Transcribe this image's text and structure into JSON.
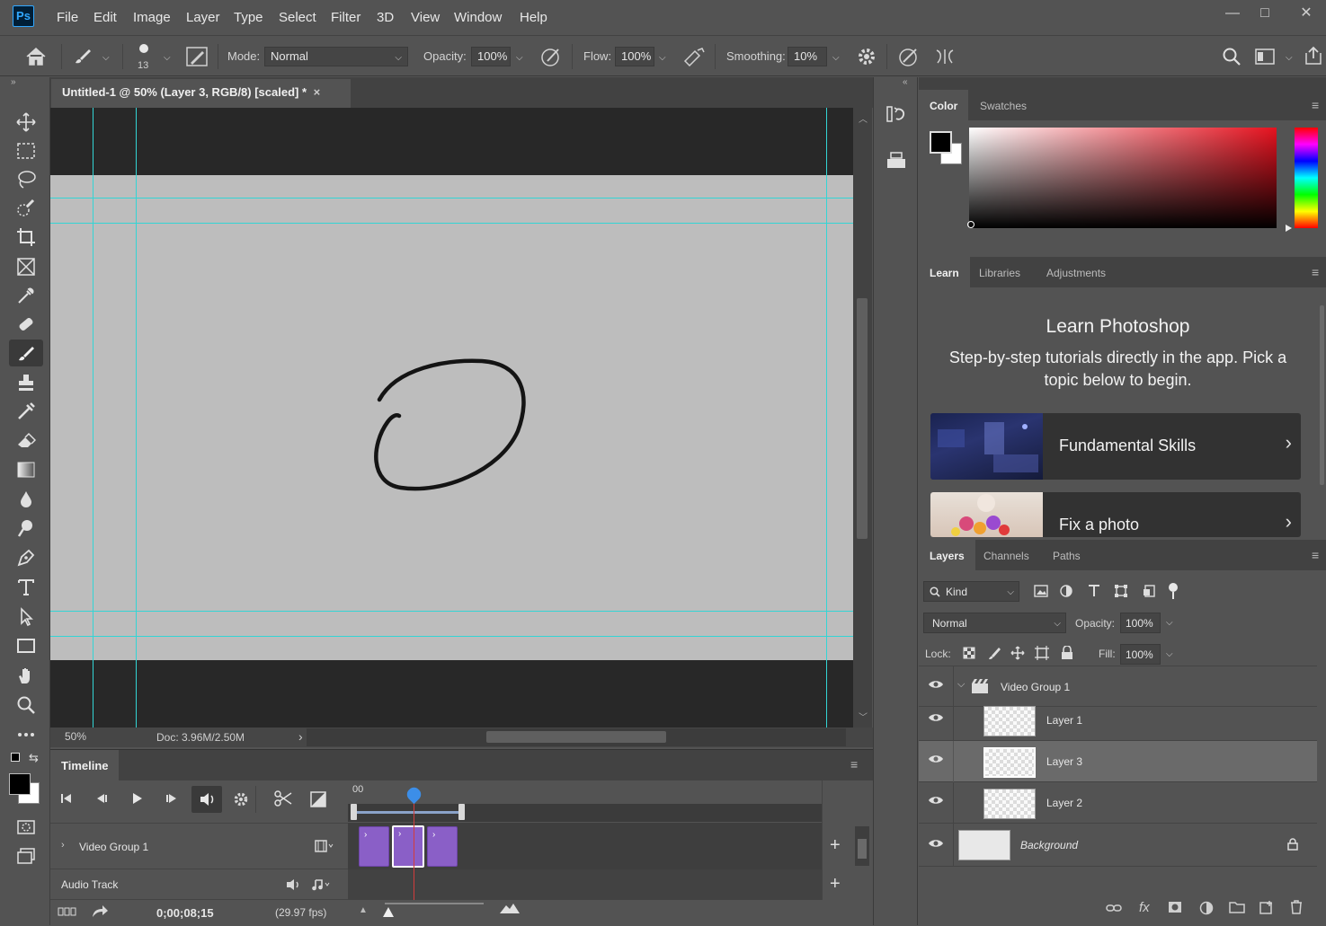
{
  "app": {
    "logo_text": "Ps"
  },
  "menu": [
    "File",
    "Edit",
    "Image",
    "Layer",
    "Type",
    "Select",
    "Filter",
    "3D",
    "View",
    "Window",
    "Help"
  ],
  "window_controls": {
    "minimize": "—",
    "restore": "□",
    "close": "✕"
  },
  "options": {
    "brush_size": "13",
    "mode_label": "Mode:",
    "mode_value": "Normal",
    "opacity_label": "Opacity:",
    "opacity_value": "100%",
    "flow_label": "Flow:",
    "flow_value": "100%",
    "smoothing_label": "Smoothing:",
    "smoothing_value": "10%"
  },
  "document": {
    "tab_title": "Untitled-1 @ 50% (Layer 3, RGB/8) [scaled] *",
    "close_glyph": "×",
    "zoom": "50%",
    "doc_info": "Doc: 3.96M/2.50M",
    "status_arrow": "›"
  },
  "timeline": {
    "title": "Timeline",
    "ruler_start": "00",
    "video_group_label": "Video Group 1",
    "audio_track_label": "Audio Track",
    "timecode": "0;00;08;15",
    "fps": "(29.97 fps)"
  },
  "color_panel": {
    "tabs": [
      "Color",
      "Swatches"
    ],
    "foreground": "#000000",
    "background": "#ffffff"
  },
  "learn_panel": {
    "tabs": [
      "Learn",
      "Libraries",
      "Adjustments"
    ],
    "title": "Learn Photoshop",
    "description": "Step-by-step tutorials directly in the app. Pick a topic below to begin.",
    "cards": [
      {
        "label": "Fundamental Skills",
        "chevron": "›"
      },
      {
        "label": "Fix a photo",
        "chevron": "›"
      }
    ]
  },
  "layers_panel": {
    "tabs": [
      "Layers",
      "Channels",
      "Paths"
    ],
    "filter_value": "Kind",
    "blend_mode": "Normal",
    "opacity_label": "Opacity:",
    "opacity_value": "100%",
    "lock_label": "Lock:",
    "fill_label": "Fill:",
    "fill_value": "100%",
    "layers": [
      {
        "name": "Video Group 1",
        "type": "group"
      },
      {
        "name": "Layer 1",
        "type": "layer"
      },
      {
        "name": "Layer 3",
        "type": "layer",
        "selected": true
      },
      {
        "name": "Layer 2",
        "type": "layer"
      },
      {
        "name": "Background",
        "type": "background",
        "locked": true
      }
    ]
  },
  "colors": {
    "accent_guide": "#33d5d5",
    "clip_purple": "#8a5fc7",
    "playhead": "#d23c3c",
    "ps_blue": "#31a8ff"
  }
}
